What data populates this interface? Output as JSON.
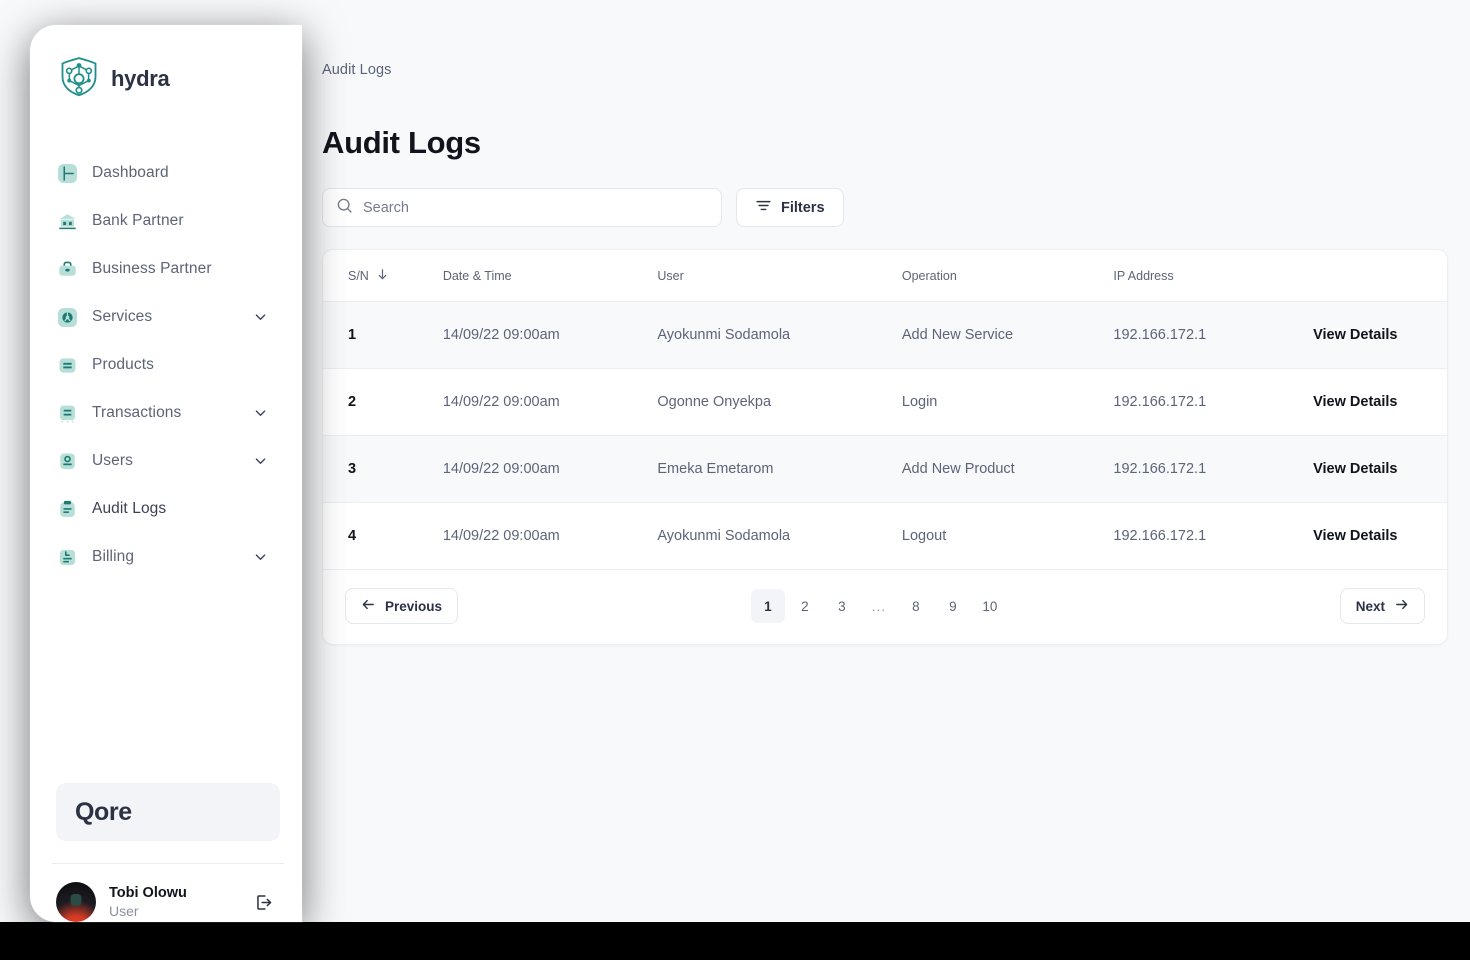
{
  "brand": {
    "name": "hydra",
    "logo_icon": "hydra-network-logo-icon"
  },
  "sidebar": {
    "items": [
      {
        "label": "Dashboard",
        "icon": "dashboard-icon",
        "chevron": false,
        "active": false
      },
      {
        "label": "Bank Partner",
        "icon": "bank-icon",
        "chevron": false,
        "active": false
      },
      {
        "label": "Business Partner",
        "icon": "briefcase-icon",
        "chevron": false,
        "active": false
      },
      {
        "label": "Services",
        "icon": "services-gear-icon",
        "chevron": true,
        "active": false
      },
      {
        "label": "Products",
        "icon": "products-box-icon",
        "chevron": false,
        "active": false
      },
      {
        "label": "Transactions",
        "icon": "transactions-icon",
        "chevron": true,
        "active": false
      },
      {
        "label": "Users",
        "icon": "users-icon",
        "chevron": true,
        "active": false
      },
      {
        "label": "Audit Logs",
        "icon": "audit-logs-clipboard-icon",
        "chevron": false,
        "active": true
      },
      {
        "label": "Billing",
        "icon": "billing-receipt-icon",
        "chevron": true,
        "active": false
      }
    ],
    "org_card": {
      "label": "Qore"
    },
    "user": {
      "name": "Tobi Olowu",
      "role": "User",
      "avatar_icon": "user-avatar",
      "logout_icon": "logout-icon"
    }
  },
  "header": {
    "breadcrumb": "Audit Logs",
    "title": "Audit Logs"
  },
  "search": {
    "placeholder": "Search",
    "value": "",
    "icon": "search-icon"
  },
  "filters_button": {
    "label": "Filters",
    "icon": "filter-icon"
  },
  "table": {
    "columns": [
      "S/N",
      "Date & Time",
      "User",
      "Operation",
      "IP Address",
      ""
    ],
    "sort_icon": "arrow-down-icon",
    "sorted_column": "S/N",
    "action_label": "View Details",
    "rows": [
      {
        "sn": "1",
        "datetime": "14/09/22 09:00am",
        "user": "Ayokunmi Sodamola",
        "operation": "Add New Service",
        "ip": "192.166.172.1",
        "action": "View Details"
      },
      {
        "sn": "2",
        "datetime": "14/09/22 09:00am",
        "user": "Ogonne Onyekpa",
        "operation": "Login",
        "ip": "192.166.172.1",
        "action": "View Details"
      },
      {
        "sn": "3",
        "datetime": "14/09/22 09:00am",
        "user": "Emeka Emetarom",
        "operation": "Add New Product",
        "ip": "192.166.172.1",
        "action": "View Details"
      },
      {
        "sn": "4",
        "datetime": "14/09/22 09:00am",
        "user": "Ayokunmi Sodamola",
        "operation": "Logout",
        "ip": "192.166.172.1",
        "action": "View Details"
      }
    ]
  },
  "pagination": {
    "previous_label": "Previous",
    "next_label": "Next",
    "pages": [
      "1",
      "2",
      "3",
      "...",
      "8",
      "9",
      "10"
    ],
    "current_page": "1"
  },
  "colors": {
    "accent": "#1f8f8a",
    "icon_bg": "#b8dfd7",
    "page_bg": "#f8f9fb",
    "text_primary": "#12141d",
    "text_secondary": "#5c6478"
  }
}
